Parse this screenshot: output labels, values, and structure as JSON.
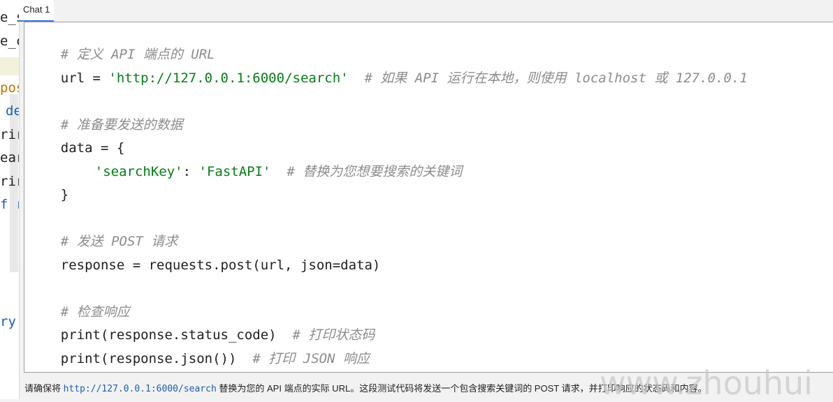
{
  "tabs": [
    {
      "label": "Chat 1",
      "active": true
    }
  ],
  "background_editor": {
    "fragments": [
      "e_s",
      "e_c",
      "pos",
      "de",
      "rir",
      "ear",
      "rir",
      "f r",
      "ry:"
    ]
  },
  "code": {
    "comment_define": "# 定义 API 端点的 URL",
    "url_prefix": "url = ",
    "url_string": "'http://127.0.0.1:6000/search'",
    "url_comment": "  # 如果 API 运行在本地，则使用 localhost 或 127.0.0.1",
    "comment_prepare": "# 准备要发送的数据",
    "data_open": "data = {",
    "data_key": "'searchKey'",
    "data_colon": ": ",
    "data_value": "'FastAPI'",
    "data_comment": "  # 替换为您想要搜索的关键词",
    "data_close": "}",
    "comment_send": "# 发送 POST 请求",
    "post_line": "response = requests.post(url, json=data)",
    "comment_check": "# 检查响应",
    "print_status": "print(response.status_code)",
    "print_status_comment": "  # 打印状态码",
    "print_json": "print(response.json())",
    "print_json_comment": "  # 打印 JSON 响应"
  },
  "footer": {
    "prefix": "请确保将 ",
    "url": "http://127.0.0.1:6000/search",
    "suffix": " 替换为您的 API 端点的实际 URL。这段测试代码将发送一个包含搜索关键词的 POST 请求，并打印响应的状态码和内容。"
  },
  "watermark": "www.zhouhui",
  "colors": {
    "tab_underline": "#3a78d8",
    "string": "#067d17",
    "comment": "#8c8c8c",
    "footer_code": "#1a5fb4"
  }
}
